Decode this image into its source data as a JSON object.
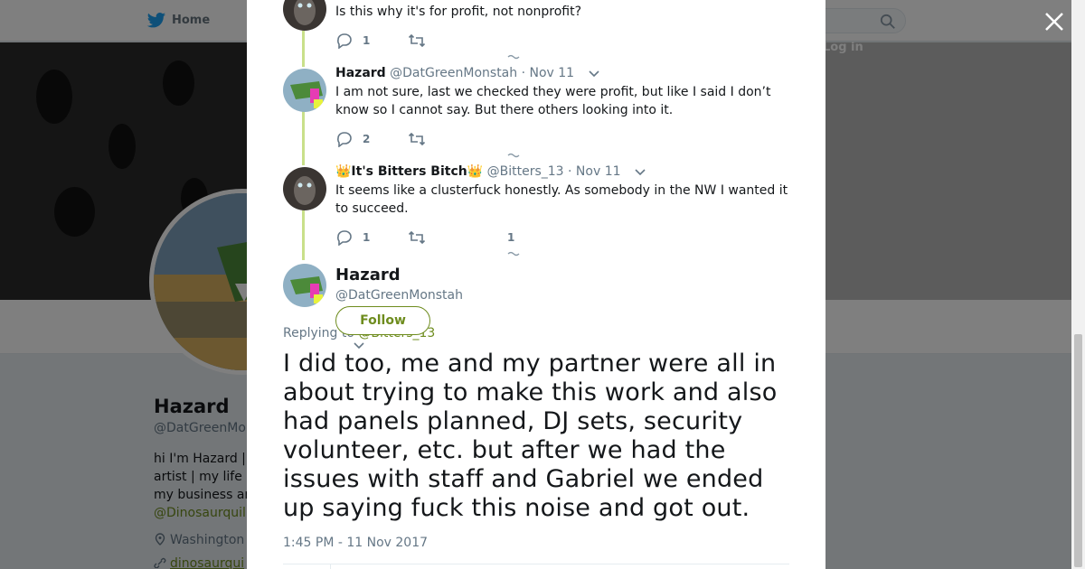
{
  "nav": {
    "home_label": "Home",
    "login_label": "Log in"
  },
  "profile": {
    "name": "Hazard",
    "handle": "@DatGreenMo",
    "bio_lines": [
      "hi I'm Hazard |",
      "artist | my life",
      "my business ar"
    ],
    "bio_link": "@Dinosaurquil",
    "location": "Washington",
    "website": "dinosaurqui"
  },
  "thread": [
    {
      "id": "t1",
      "name": "",
      "handle": "",
      "date": "",
      "text": "Is this why it's for profit, not nonprofit?",
      "replies": "1",
      "retweets": "",
      "likes": ""
    },
    {
      "id": "t2",
      "name": "Hazard",
      "handle": "@DatGreenMonstah",
      "date": "· Nov 11",
      "text": "I am not sure, last we checked they were profit, but like I said I don’t know so I cannot say. But there others looking into it.",
      "replies": "2",
      "retweets": "",
      "likes": ""
    },
    {
      "id": "t3",
      "name": "👑It's Bitters Bitch👑",
      "handle": "@Bitters_13",
      "date": "· Nov 11",
      "text": "It seems like a clusterfuck honestly. As somebody in the NW I wanted it to succeed.",
      "replies": "1",
      "retweets": "",
      "likes": "1"
    }
  ],
  "main_tweet": {
    "name": "Hazard",
    "handle": "@DatGreenMonstah",
    "follow_label": "Follow",
    "replying_prefix": "Replying to ",
    "replying_handle": "@Bitters_13",
    "text": "I did too, me and my partner were all in about trying to make this work and also had panels planned, DJ sets, security volunteer, etc. but after we had the issues with staff and Gabriel we ended up saying fuck this noise and got out.",
    "timestamp": "1:45 PM - 11 Nov 2017"
  },
  "colors": {
    "accent": "#6e8c1e",
    "thread_line": "#c9e08a",
    "muted": "#657786",
    "twitter_blue": "#1da1f2"
  },
  "icons": [
    "twitter-bird-icon",
    "search-icon",
    "close-icon",
    "reply-icon",
    "retweet-icon",
    "caret-down-icon",
    "location-pin-icon",
    "link-icon"
  ]
}
